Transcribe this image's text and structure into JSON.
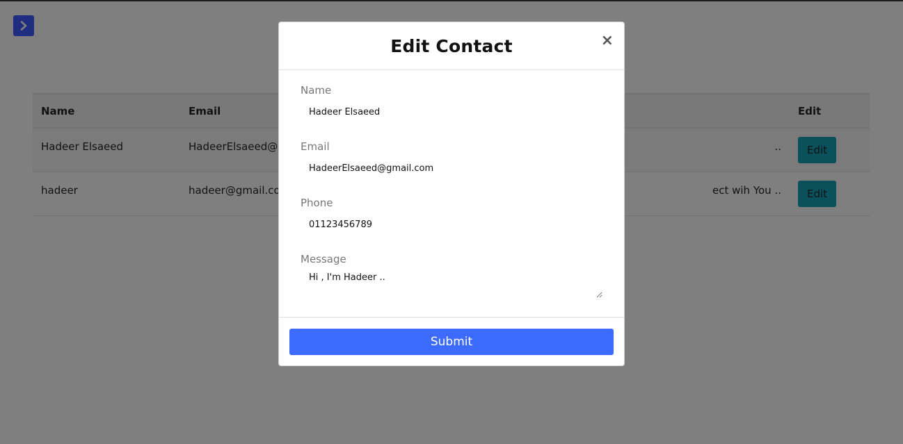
{
  "sidebar_toggle": {
    "icon": "chevron-right-icon"
  },
  "table": {
    "headers": [
      "Name",
      "Email",
      "",
      "Edit"
    ],
    "rows": [
      {
        "name": "Hadeer Elsaeed",
        "email": "HadeerElsaeed@g",
        "message": "..",
        "edit": "Edit"
      },
      {
        "name": "hadeer",
        "email": "hadeer@gmail.con",
        "message": "ect wih You ..",
        "edit": "Edit"
      }
    ]
  },
  "modal": {
    "title": "Edit Contact",
    "close": "×",
    "fields": {
      "name": {
        "label": "Name",
        "value": "Hadeer Elsaeed"
      },
      "email": {
        "label": "Email",
        "value": "HadeerElsaeed@gmail.com"
      },
      "phone": {
        "label": "Phone",
        "value": "01123456789"
      },
      "message": {
        "label": "Message",
        "value": "Hi , I'm Hadeer .."
      }
    },
    "submit": "Submit"
  },
  "colors": {
    "accent": "#3d6bff",
    "edit_button": "#17a2b8",
    "backdrop": "rgba(0,0,0,0.5)"
  }
}
